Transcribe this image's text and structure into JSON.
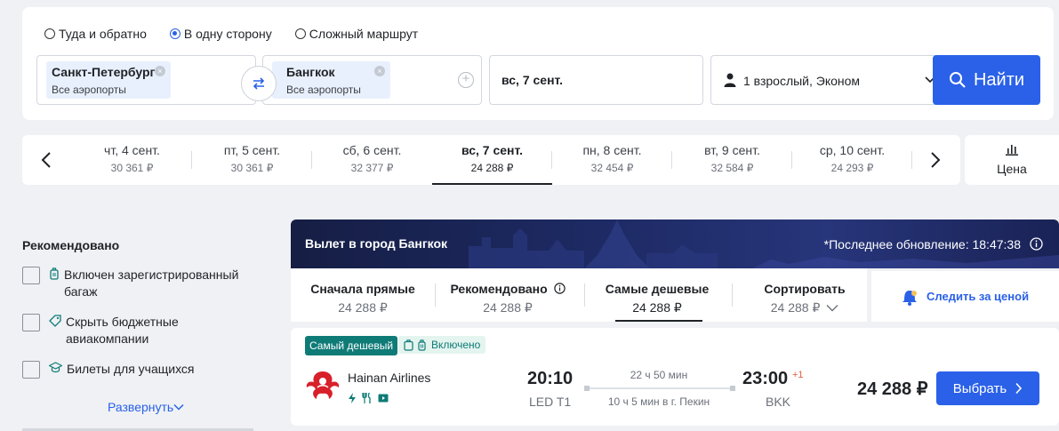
{
  "search": {
    "trip_types": [
      {
        "label": "Туда и обратно",
        "checked": false
      },
      {
        "label": "В одну сторону",
        "checked": true
      },
      {
        "label": "Сложный маршрут",
        "checked": false
      }
    ],
    "origin": {
      "city": "Санкт-Петербург",
      "airports": "Все аэропорты"
    },
    "destination": {
      "city": "Бангкок",
      "airports": "Все аэропорты"
    },
    "date": "вс, 7 сент.",
    "passengers": "1 взрослый, Эконом",
    "find_label": "Найти"
  },
  "date_strip": {
    "days": [
      {
        "date": "чт, 4 сент.",
        "price": "30 361 ₽"
      },
      {
        "date": "пт, 5 сент.",
        "price": "30 361 ₽"
      },
      {
        "date": "сб, 6 сент.",
        "price": "32 377 ₽"
      },
      {
        "date": "вс, 7 сент.",
        "price": "24 288 ₽",
        "active": true
      },
      {
        "date": "пн, 8 сент.",
        "price": "32 454 ₽"
      },
      {
        "date": "вт, 9 сент.",
        "price": "32 584 ₽"
      },
      {
        "date": "ср, 10 сент.",
        "price": "24 293 ₽"
      }
    ],
    "price_sort_label": "Цена"
  },
  "filters": {
    "title": "Рекомендовано",
    "items": [
      {
        "label": "Включен зарегистрированный багаж",
        "icon": "luggage-icon"
      },
      {
        "label": "Скрыть бюджетные авиакомпании",
        "icon": "tag-icon"
      },
      {
        "label": "Билеты для учащихся",
        "icon": "graduation-cap-icon"
      }
    ],
    "expand_label": "Развернуть"
  },
  "results": {
    "banner_title": "Вылет в город Бангкок",
    "last_update": "*Последнее обновление: 18:47:38",
    "sort_tabs": [
      {
        "title": "Сначала прямые",
        "value": "24 288 ₽"
      },
      {
        "title": "Рекомендовано",
        "value": "24 288 ₽"
      },
      {
        "title": "Самые дешевые",
        "value": "24 288 ₽",
        "active": true
      },
      {
        "title": "Сортировать",
        "value": "24 288 ₽"
      }
    ],
    "track_price_label": "Следить за ценой",
    "ticket": {
      "badge_cheapest": "Самый дешевый",
      "badge_baggage": "Включено",
      "airline": "Hainan Airlines",
      "dep_time": "20:10",
      "dep_airport": "LED T1",
      "duration": "22 ч 50 мин",
      "stop": "10 ч 5 мин в г. Пекин",
      "arr_time": "23:00",
      "arr_plus": "+1",
      "arr_airport": "BKK",
      "price": "24 288 ₽",
      "select_label": "Выбрать"
    }
  },
  "colors": {
    "accent": "#2a61e8",
    "teal": "#0f7b77",
    "banner": "#1d2a64"
  }
}
